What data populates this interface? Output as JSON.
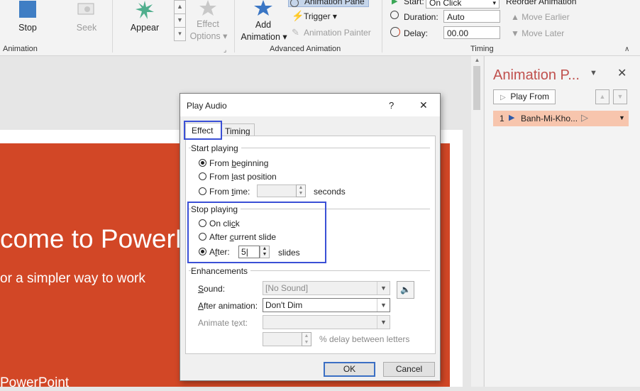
{
  "ribbon": {
    "stop": "Stop",
    "seek": "Seek",
    "appear": "Appear",
    "effect_options_1": "Effect",
    "effect_options_2": "Options",
    "add_animation_1": "Add",
    "add_animation_2": "Animation",
    "animation_pane": "Animation Pane",
    "trigger": "Trigger",
    "animation_painter": "Animation Painter",
    "start_label": "Start:",
    "start_value": "On Click",
    "duration_label": "Duration:",
    "duration_value": "Auto",
    "delay_label": "Delay:",
    "delay_value": "00.00",
    "reorder": "Reorder Animation",
    "move_earlier": "Move Earlier",
    "move_later": "Move Later",
    "group_animation": "Animation",
    "group_advanced": "Advanced Animation",
    "group_timing": "Timing"
  },
  "slide": {
    "title": "come to PowerP",
    "subtitle": "or a simpler way to work",
    "footer": "PowerPoint"
  },
  "pane": {
    "title": "Animation P...",
    "play_from": "Play From",
    "item_number": "1",
    "item_name": "Banh-Mi-Kho..."
  },
  "dialog": {
    "title": "Play Audio",
    "help": "?",
    "close": "✕",
    "tab_effect": "Effect",
    "tab_timing": "Timing",
    "start_playing": "Start playing",
    "from_beginning_pre": "From ",
    "from_beginning_u": "b",
    "from_beginning_post": "eginning",
    "from_last_pre": "From ",
    "from_last_u": "l",
    "from_last_post": "ast position",
    "from_time_pre": "From ",
    "from_time_u": "t",
    "from_time_post": "ime:",
    "seconds": "seconds",
    "stop_playing": "Stop playing",
    "on_click_pre": "On cli",
    "on_click_u": "c",
    "on_click_post": "k",
    "after_current_pre": "After ",
    "after_current_u": "c",
    "after_current_post": "urrent slide",
    "after_pre": "A",
    "after_u": "f",
    "after_post": "ter:",
    "after_value": "5",
    "slides": "slides",
    "enhancements": "Enhancements",
    "sound_label_u": "S",
    "sound_label_post": "ound:",
    "sound_value": "[No Sound]",
    "after_anim_pre": "",
    "after_anim_u": "A",
    "after_anim_post": "fter animation:",
    "after_anim_value": "Don't Dim",
    "animate_text": "Animate te̱xt:",
    "delay_between": "% delay between letters",
    "ok": "OK",
    "cancel": "Cancel"
  }
}
